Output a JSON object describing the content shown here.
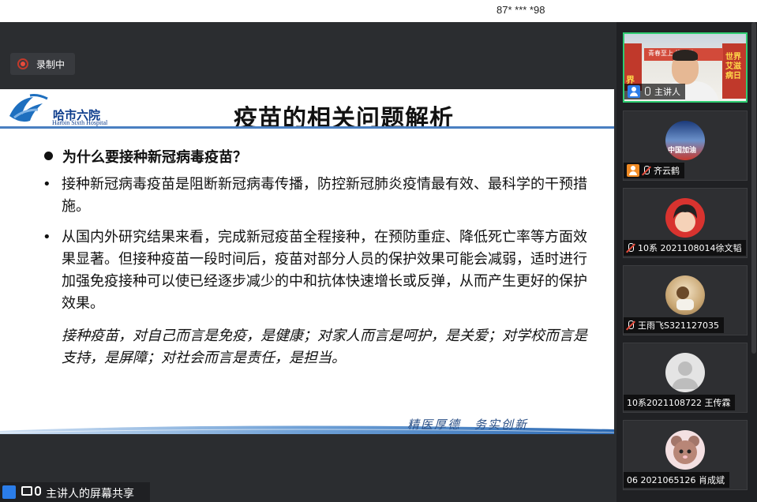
{
  "topbar": {
    "meeting_id": "87* *** *98"
  },
  "recording": {
    "label": "录制中"
  },
  "slide": {
    "logo_cn": "哈市六院",
    "logo_en": "Harbin Sixth Hospital",
    "title": "疫苗的相关问题解析",
    "question": "为什么要接种新冠病毒疫苗？",
    "paragraph1": "接种新冠病毒疫苗是阻断新冠病毒传播，防控新冠肺炎疫情最有效、最科学的干预措施。",
    "paragraph2": "从国内外研究结果来看，完成新冠疫苗全程接种，在预防重症、降低死亡率等方面效果显著。但接种疫苗一段时间后，疫苗对部分人员的保护效果可能会减弱，适时进行加强免疫接种可以使已经逐步减少的中和抗体快速增长或反弹，从而产生更好的保护效果。",
    "paragraph3": "接种疫苗，对自己而言是免疫，是健康；对家人而言是呵护，是关爱；对学校而言是支持，是屏障；对社会而言是责任，是担当。",
    "slogan": "精医厚德　务实创新"
  },
  "share": {
    "label": "主讲人的屏幕共享"
  },
  "participants": [
    {
      "name": "主讲人",
      "video_text_left": "界",
      "video_text_mid": "青春至上 携手共",
      "video_text_right": "世界艾滋病日"
    },
    {
      "name": "齐云鹤",
      "avatar_text": "中国加油"
    },
    {
      "name": "10系 2021108014徐文韬"
    },
    {
      "name": "王雨飞S321127035"
    },
    {
      "name": "10系2021108722 王传霖"
    },
    {
      "name": "06 2021065126 肖成斌"
    }
  ],
  "colors": {
    "accent_blue": "#2b7de9",
    "host_orange": "#f08a24",
    "active_border": "#2ecc71",
    "record_red": "#e74c3c"
  }
}
